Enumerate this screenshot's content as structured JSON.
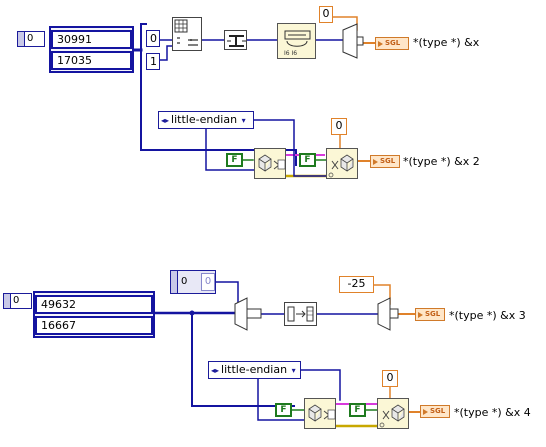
{
  "block1": {
    "index_value": "0",
    "array_values": [
      "30991",
      "17035"
    ],
    "index_labels": [
      "0",
      "1"
    ],
    "offset_value": "0",
    "output_label": "*(type *) &x"
  },
  "block2": {
    "endian": "little-endian",
    "bool_a": "F",
    "bool_b": "F",
    "offset_value": "0",
    "output_label": "*(type *) &x 2"
  },
  "block3": {
    "index_value": "0",
    "array_values": [
      "49632",
      "16667"
    ],
    "const_small": [
      "0",
      "0"
    ],
    "offset_value": "-25",
    "output_label": "*(type *) &x 3"
  },
  "block4": {
    "endian": "little-endian",
    "bool_a": "F",
    "bool_b": "F",
    "offset_value": "0",
    "output_label": "*(type *) &x 4"
  },
  "indicator_type": "SGL",
  "icons": {
    "join": "join-numbers-icon",
    "typecast": "type-cast-icon",
    "swap": "swap-words-icon",
    "unflatten": "unflatten-from-string-icon",
    "select": "select-icon",
    "coerce": "coerce-to-sgl-icon"
  }
}
